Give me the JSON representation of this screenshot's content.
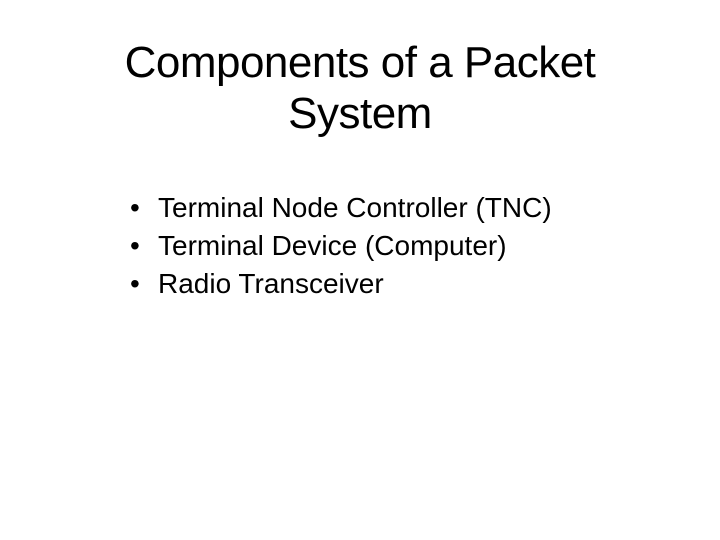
{
  "slide": {
    "title": "Components of a Packet System",
    "bullets": [
      "Terminal Node Controller (TNC)",
      "Terminal Device (Computer)",
      "Radio Transceiver"
    ]
  }
}
